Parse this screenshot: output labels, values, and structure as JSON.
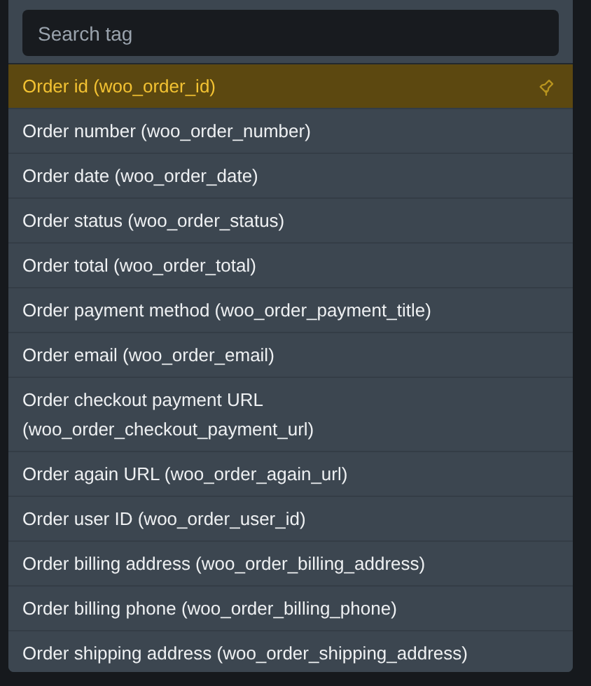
{
  "search": {
    "placeholder": "Search tag"
  },
  "tags": [
    {
      "label": "Order id (woo_order_id)",
      "selected": true
    },
    {
      "label": "Order number (woo_order_number)",
      "selected": false
    },
    {
      "label": "Order date (woo_order_date)",
      "selected": false
    },
    {
      "label": "Order status (woo_order_status)",
      "selected": false
    },
    {
      "label": "Order total (woo_order_total)",
      "selected": false
    },
    {
      "label": "Order payment method (woo_order_payment_title)",
      "selected": false
    },
    {
      "label": "Order email (woo_order_email)",
      "selected": false
    },
    {
      "label": "Order checkout payment URL (woo_order_checkout_payment_url)",
      "selected": false
    },
    {
      "label": "Order again URL (woo_order_again_url)",
      "selected": false
    },
    {
      "label": "Order user ID (woo_order_user_id)",
      "selected": false
    },
    {
      "label": "Order billing address (woo_order_billing_address)",
      "selected": false
    },
    {
      "label": "Order billing phone (woo_order_billing_phone)",
      "selected": false
    },
    {
      "label": "Order shipping address (woo_order_shipping_address)",
      "selected": false
    }
  ]
}
